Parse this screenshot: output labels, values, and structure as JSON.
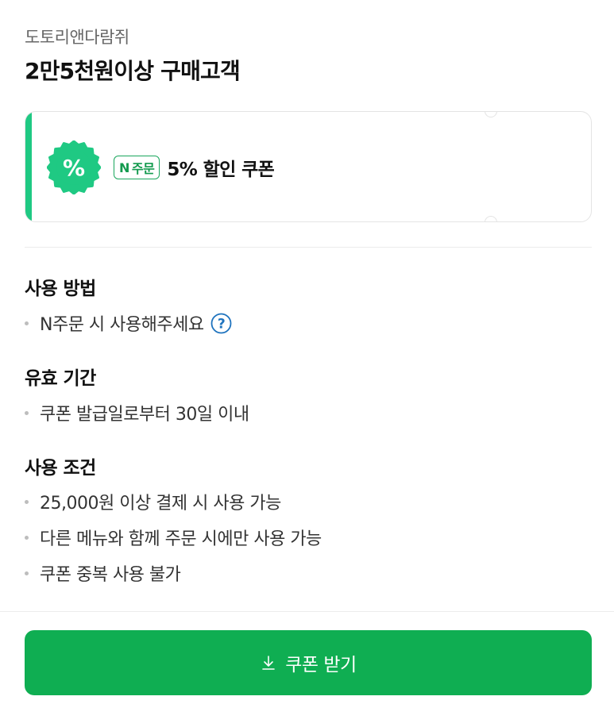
{
  "store": {
    "name": "도토리앤다람쥐"
  },
  "title": "2만5천원이상 구매고객",
  "coupon": {
    "icon": "percent-badge-icon",
    "tag_letter": "N",
    "tag_text": "주문",
    "label": "5% 할인 쿠폰",
    "accent_color": "#1fc983"
  },
  "sections": {
    "usage_method": {
      "heading": "사용 방법",
      "items": [
        "N주문 시 사용해주세요"
      ],
      "help_icon": "question-circle-icon"
    },
    "validity": {
      "heading": "유효 기간",
      "items": [
        "쿠폰 발급일로부터 30일 이내"
      ]
    },
    "conditions": {
      "heading": "사용 조건",
      "items": [
        "25,000원 이상 결제 시 사용 가능",
        "다른 메뉴와 함께 주문 시에만 사용 가능",
        "쿠폰 중복 사용 불가"
      ]
    }
  },
  "action": {
    "label": "쿠폰 받기",
    "icon": "download-icon",
    "color": "#0fae52"
  }
}
